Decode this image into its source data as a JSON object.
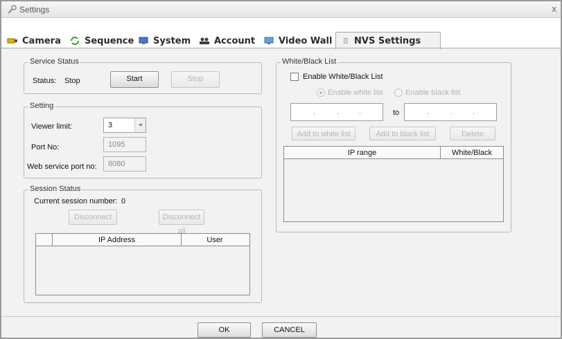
{
  "window": {
    "title": "Settings",
    "close": "x"
  },
  "tabs": [
    {
      "label": "Camera",
      "icon": "camera-icon"
    },
    {
      "label": "Sequence",
      "icon": "sequence-icon"
    },
    {
      "label": "System",
      "icon": "monitor-icon"
    },
    {
      "label": "Account",
      "icon": "users-icon"
    },
    {
      "label": "Video Wall",
      "icon": "video-wall-icon"
    },
    {
      "label": "NVS Settings",
      "icon": "document-icon",
      "active": true
    }
  ],
  "service_status": {
    "legend": "Service Status",
    "status_label": "Status:",
    "status_value": "Stop",
    "start_label": "Start",
    "stop_label": "Stop"
  },
  "setting": {
    "legend": "Setting",
    "viewer_limit_label": "Viewer limit:",
    "viewer_limit_value": "3",
    "port_label": "Port No:",
    "port_value": "1095",
    "web_port_label": "Web service port no:",
    "web_port_value": "8080"
  },
  "session_status": {
    "legend": "Session Status",
    "current_label": "Current session number:",
    "current_value": "0",
    "disconnect_label": "Disconnect",
    "disconnect_all_label": "Disconnect all",
    "columns": [
      "IP Address",
      "User"
    ]
  },
  "white_black": {
    "legend": "White/Black List",
    "enable_label": "Enable White/Black List",
    "enable_white_label": "Enable white list",
    "enable_black_label": "Enable black list",
    "to_label": "to",
    "ip_dot": ".",
    "add_white_label": "Add to white list",
    "add_black_label": "Add to black list",
    "delete_label": "Delete",
    "columns": [
      "IP range",
      "White/Black"
    ]
  },
  "footer": {
    "ok_label": "OK",
    "cancel_label": "CANCEL"
  },
  "colors": {
    "background": "#f2f2f2",
    "border": "#b9b9b9",
    "disabled_text": "#b6b6b6"
  }
}
